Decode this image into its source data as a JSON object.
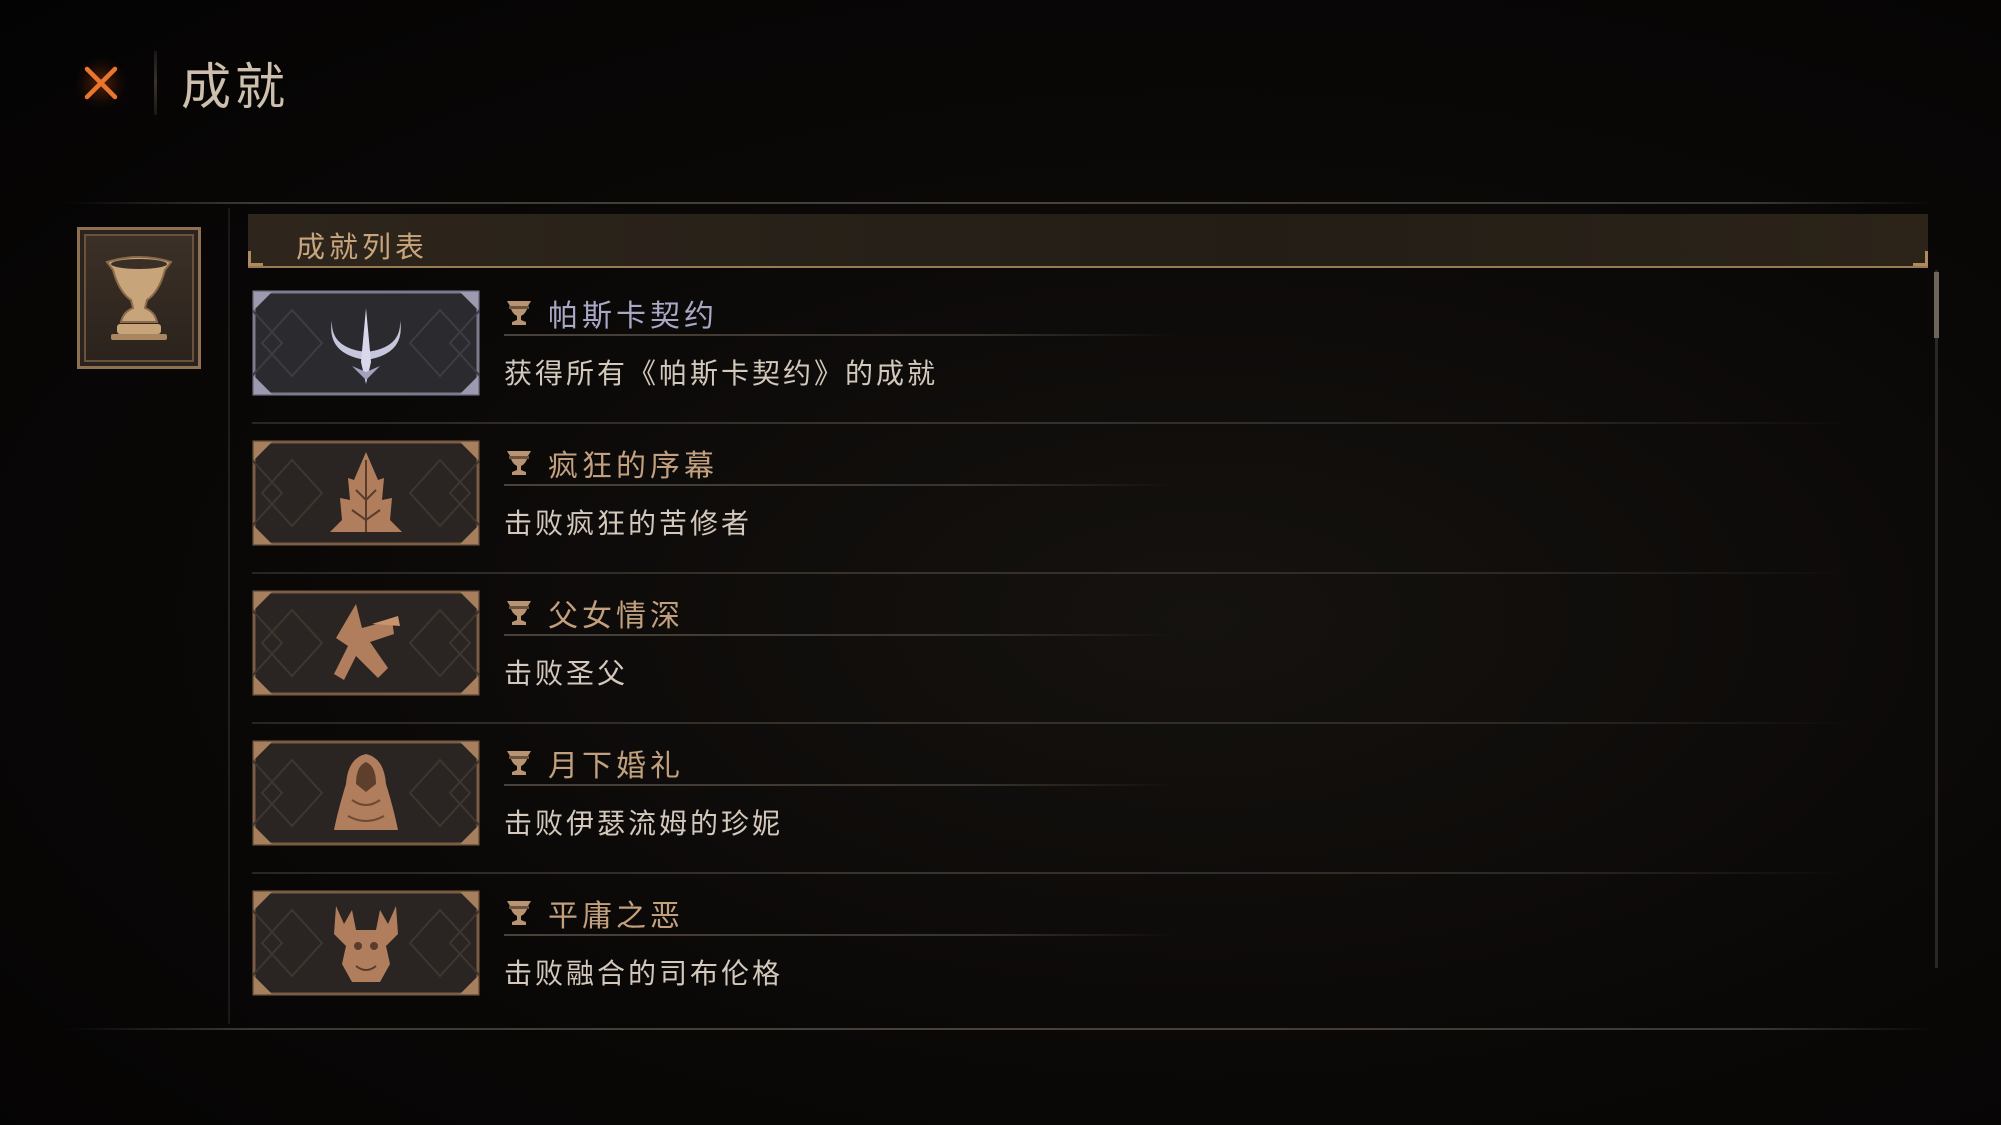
{
  "header": {
    "title": "成就",
    "close_icon": "close-x-icon"
  },
  "category": {
    "icon": "chalice-icon",
    "list_title": "成就列表"
  },
  "achievements": [
    {
      "title": "帕斯卡契约",
      "description": "获得所有《帕斯卡契约》的成就",
      "icon": "crescent-blade-icon",
      "trophy_icon": "trophy-icon",
      "accent": "#a8a8c6"
    },
    {
      "title": "疯狂的序幕",
      "description": "击败疯狂的苦修者",
      "icon": "thorn-spire-icon",
      "trophy_icon": "trophy-icon",
      "accent": "#c2a07e"
    },
    {
      "title": "父女情深",
      "description": "击败圣父",
      "icon": "twisted-figure-icon",
      "trophy_icon": "trophy-icon",
      "accent": "#c2a07e"
    },
    {
      "title": "月下婚礼",
      "description": "击败伊瑟流姆的珍妮",
      "icon": "hooded-bride-icon",
      "trophy_icon": "trophy-icon",
      "accent": "#c2a07e"
    },
    {
      "title": "平庸之恶",
      "description": "击败融合的司布伦格",
      "icon": "antlered-beast-icon",
      "trophy_icon": "trophy-icon",
      "accent": "#c2a07e"
    }
  ],
  "colors": {
    "background": "#0a0807",
    "accent_bronze": "#b08a5c",
    "close_orange": "#e06a22"
  }
}
